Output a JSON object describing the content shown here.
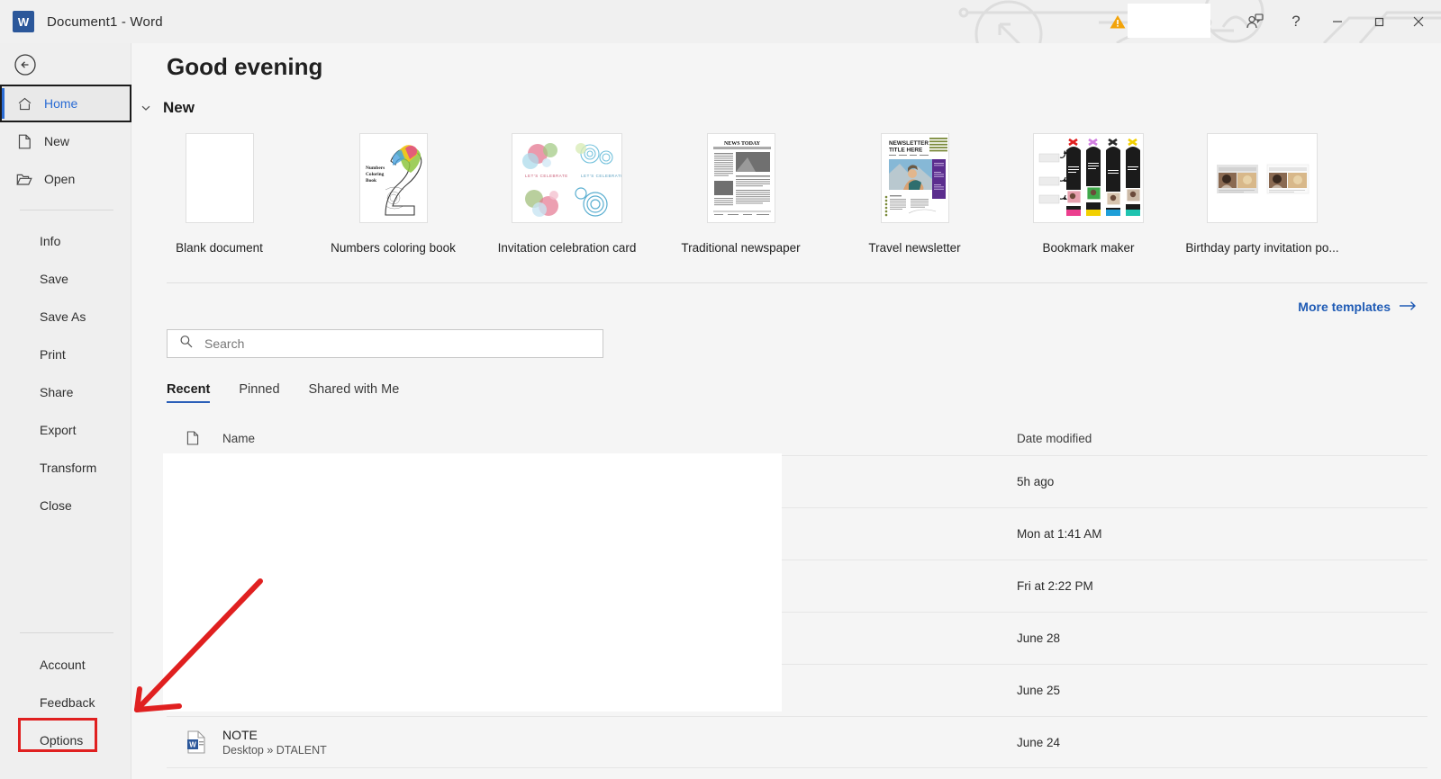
{
  "titlebar": {
    "app_icon": "word-logo-icon",
    "title": "Document1  -  Word",
    "warning_icon": "warning-triangle-icon",
    "redaction_label": "",
    "account_icon": "account-person-icon",
    "help_label": "?",
    "minimize_label": "minimize-icon",
    "restore_label": "restore-icon",
    "close_label": "close-icon"
  },
  "sidebar": {
    "back_icon": "back-arrow-icon",
    "top_items": [
      {
        "label": "Home",
        "icon": "home-icon",
        "active": true
      },
      {
        "label": "New",
        "icon": "new-document-icon",
        "active": false
      },
      {
        "label": "Open",
        "icon": "open-folder-icon",
        "active": false
      }
    ],
    "mid_items": [
      {
        "label": "Info"
      },
      {
        "label": "Save"
      },
      {
        "label": "Save As"
      },
      {
        "label": "Print"
      },
      {
        "label": "Share"
      },
      {
        "label": "Export"
      },
      {
        "label": "Transform"
      },
      {
        "label": "Close"
      }
    ],
    "bottom_items": [
      {
        "label": "Account",
        "highlight": false
      },
      {
        "label": "Feedback",
        "highlight": false
      },
      {
        "label": "Options",
        "highlight": true
      }
    ]
  },
  "main": {
    "greeting": "Good evening",
    "new_section": {
      "label": "New",
      "chevron_icon": "chevron-down-icon",
      "templates": [
        {
          "name": "Blank document",
          "thumb": "blank-page-thumb"
        },
        {
          "name": "Numbers coloring book",
          "thumb": "numbers-coloring-book-thumb"
        },
        {
          "name": "Invitation celebration card",
          "thumb": "invitation-celebration-card-thumb"
        },
        {
          "name": "Traditional newspaper",
          "thumb": "traditional-newspaper-thumb"
        },
        {
          "name": "Travel newsletter",
          "thumb": "travel-newsletter-thumb"
        },
        {
          "name": "Bookmark maker",
          "thumb": "bookmark-maker-thumb"
        },
        {
          "name": "Birthday party invitation po...",
          "thumb": "birthday-party-invitation-thumb"
        }
      ],
      "more_templates_label": "More templates",
      "more_templates_icon": "arrow-right-icon"
    },
    "search": {
      "placeholder": "Search",
      "value": "",
      "icon": "search-icon"
    },
    "tabs": [
      {
        "label": "Recent",
        "active": true
      },
      {
        "label": "Pinned",
        "active": false
      },
      {
        "label": "Shared with Me",
        "active": false
      }
    ],
    "table": {
      "columns": {
        "name": "Name",
        "date": "Date modified",
        "name_icon": "document-icon"
      },
      "rows": [
        {
          "title": "",
          "path": "",
          "date": "5h ago",
          "redacted": true
        },
        {
          "title": "",
          "path": "",
          "date": "Mon at 1:41 AM",
          "redacted": true
        },
        {
          "title": "",
          "path": "",
          "date": "Fri at 2:22 PM",
          "redacted": true
        },
        {
          "title": "",
          "path": "",
          "date": "June 28",
          "redacted": true
        },
        {
          "title": "",
          "path": "",
          "date": "June 25",
          "redacted": true
        },
        {
          "title": "NOTE",
          "path": "Desktop » DTALENT",
          "date": "June 24",
          "redacted": false
        }
      ]
    }
  },
  "annotations": {
    "arrow_color": "#e02020",
    "highlight_box_color": "#e02020",
    "arrow_target": "Options"
  },
  "colors": {
    "accent": "#2b6cd4",
    "link": "#1f5bb5",
    "sidebar_bg": "#efefef",
    "content_bg": "#f5f5f5",
    "word_blue": "#2b579a"
  }
}
